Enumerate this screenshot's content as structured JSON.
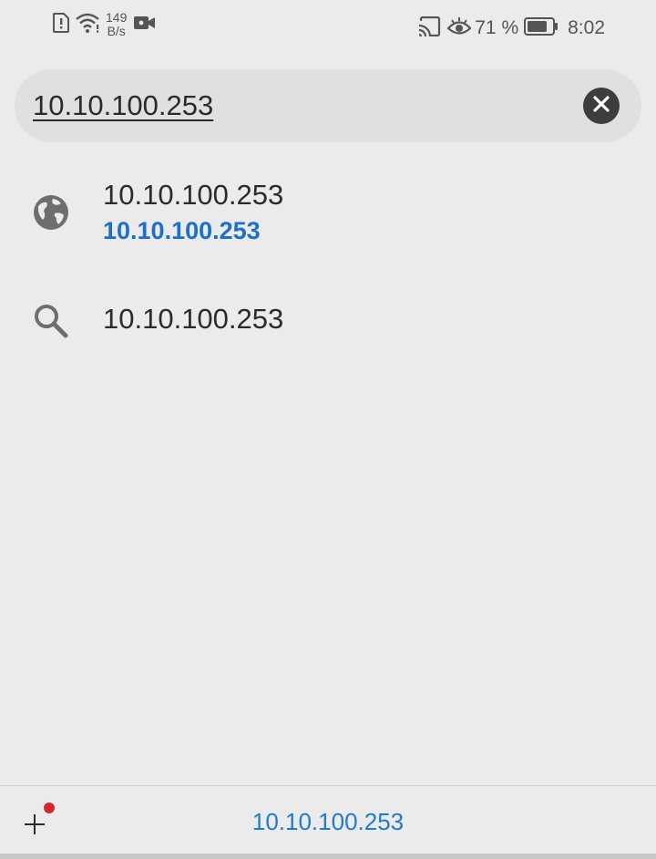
{
  "status_bar": {
    "data_rate_value": "149",
    "data_rate_unit": "B/s",
    "battery_percent": "71 %",
    "time": "8:02",
    "icons": [
      "sim-alert-icon",
      "wifi-icon",
      "video-camera-icon",
      "cast-icon",
      "eye-comfort-icon",
      "battery-icon"
    ]
  },
  "search": {
    "value": "10.10.100.253",
    "clear_icon": "close-icon"
  },
  "suggestions": [
    {
      "icon": "globe-icon",
      "primary": "10.10.100.253",
      "secondary": "10.10.100.253"
    },
    {
      "icon": "search-icon",
      "primary": "10.10.100.253"
    }
  ],
  "bottom_bar": {
    "new_tab_icon": "plus-icon",
    "url": "10.10.100.253"
  },
  "colors": {
    "background": "#ebebeb",
    "search_bg": "#dfe0e2",
    "link_blue": "#1d6fce",
    "notification_red": "#d7262b"
  }
}
